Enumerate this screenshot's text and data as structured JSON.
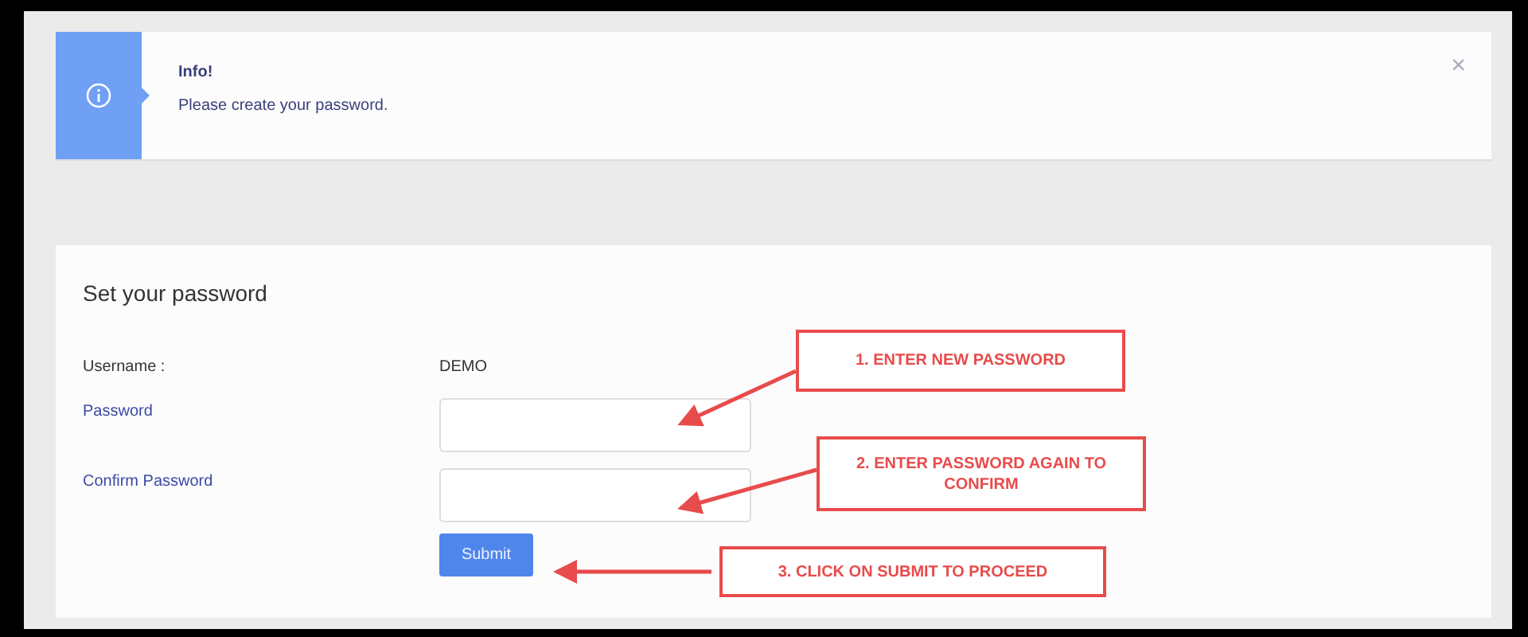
{
  "alert": {
    "title": "Info!",
    "message": "Please create your password.",
    "close": "×"
  },
  "form": {
    "title": "Set your password",
    "username_label": "Username :",
    "username_value": "DEMO",
    "fields": [
      {
        "label": "Password"
      },
      {
        "label": "Confirm Password"
      }
    ],
    "submit": "Submit"
  },
  "callouts": [
    {
      "text": "1. ENTER NEW PASSWORD"
    },
    {
      "text": "2. ENTER PASSWORD AGAIN TO CONFIRM"
    },
    {
      "text": "3. CLICK ON SUBMIT TO PROCEED"
    }
  ]
}
